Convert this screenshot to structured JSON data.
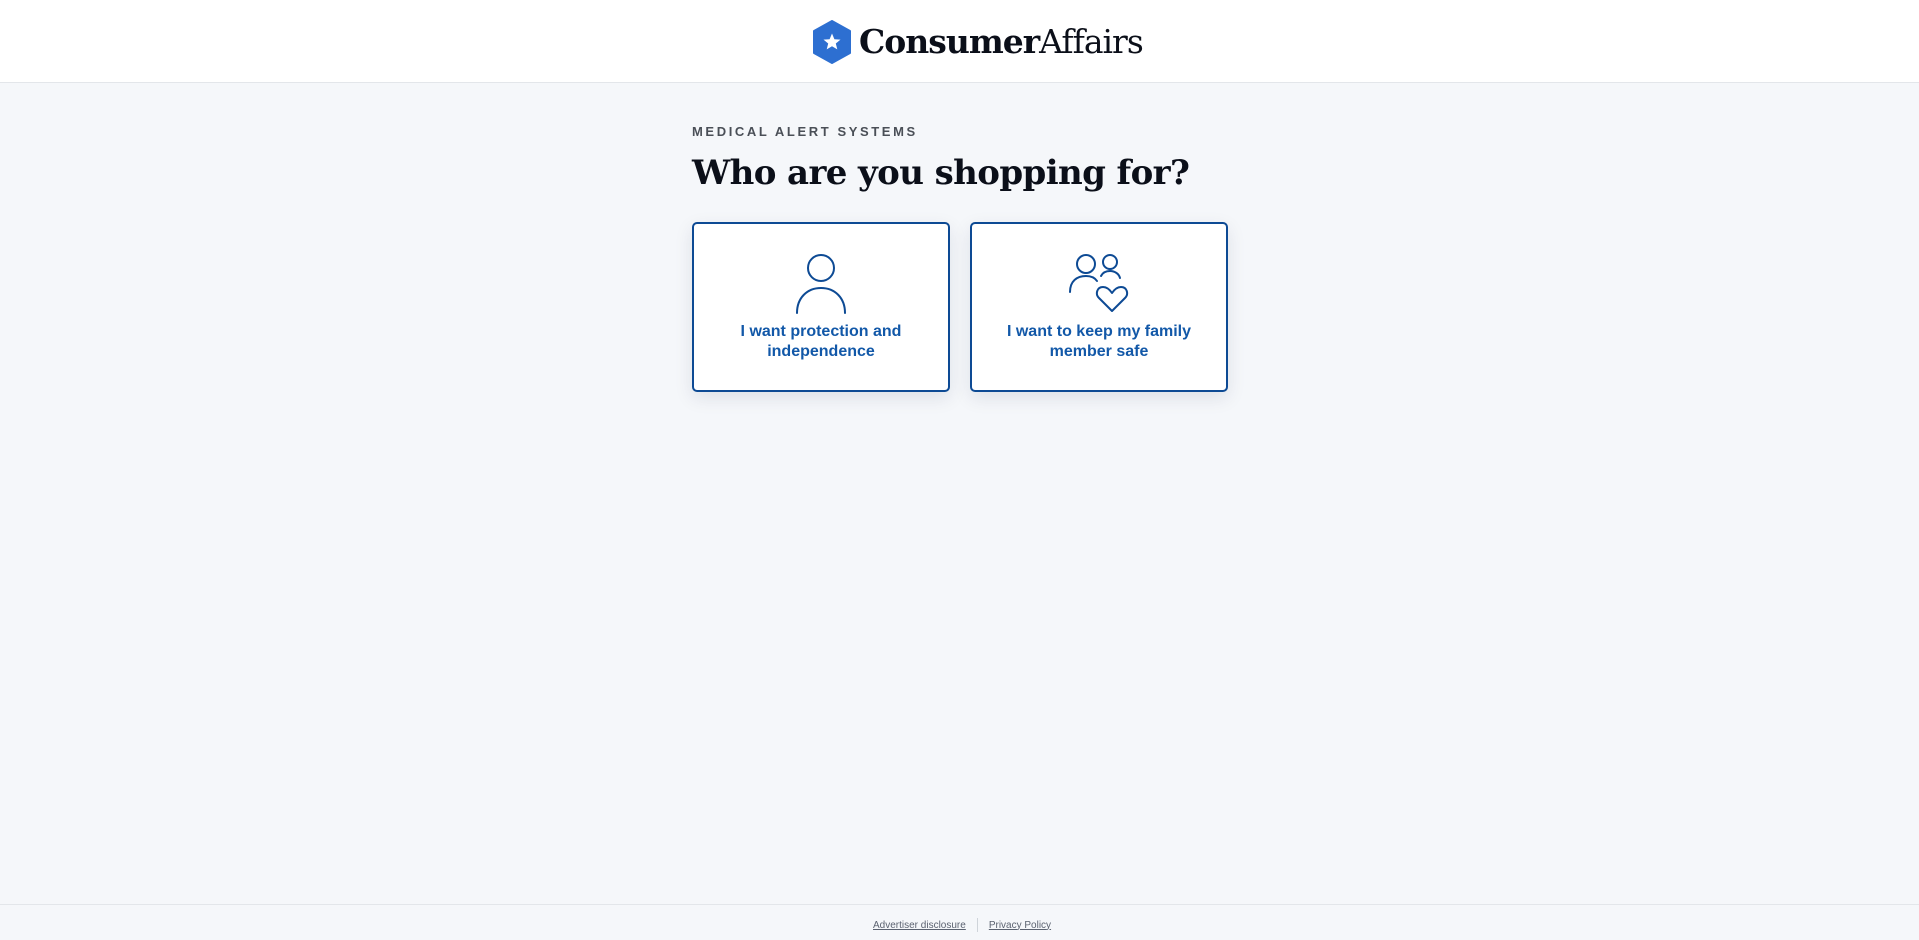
{
  "header": {
    "logo": {
      "bold_text": "Consumer",
      "light_text": "Affairs",
      "mark_icon": "star-hexagon-icon",
      "mark_color": "#2d6fd1"
    }
  },
  "main": {
    "eyebrow": "MEDICAL ALERT SYSTEMS",
    "title": "Who are you shopping for?",
    "options": [
      {
        "icon": "person-icon",
        "label": "I want protection and independence"
      },
      {
        "icon": "family-heart-icon",
        "label": "I want to keep my family member safe"
      }
    ]
  },
  "footer": {
    "advertiser_disclosure": "Advertiser disclosure",
    "privacy_policy": "Privacy Policy"
  },
  "colors": {
    "accent": "#0d4a94",
    "label": "#1258a8",
    "background": "#f5f7fa"
  }
}
